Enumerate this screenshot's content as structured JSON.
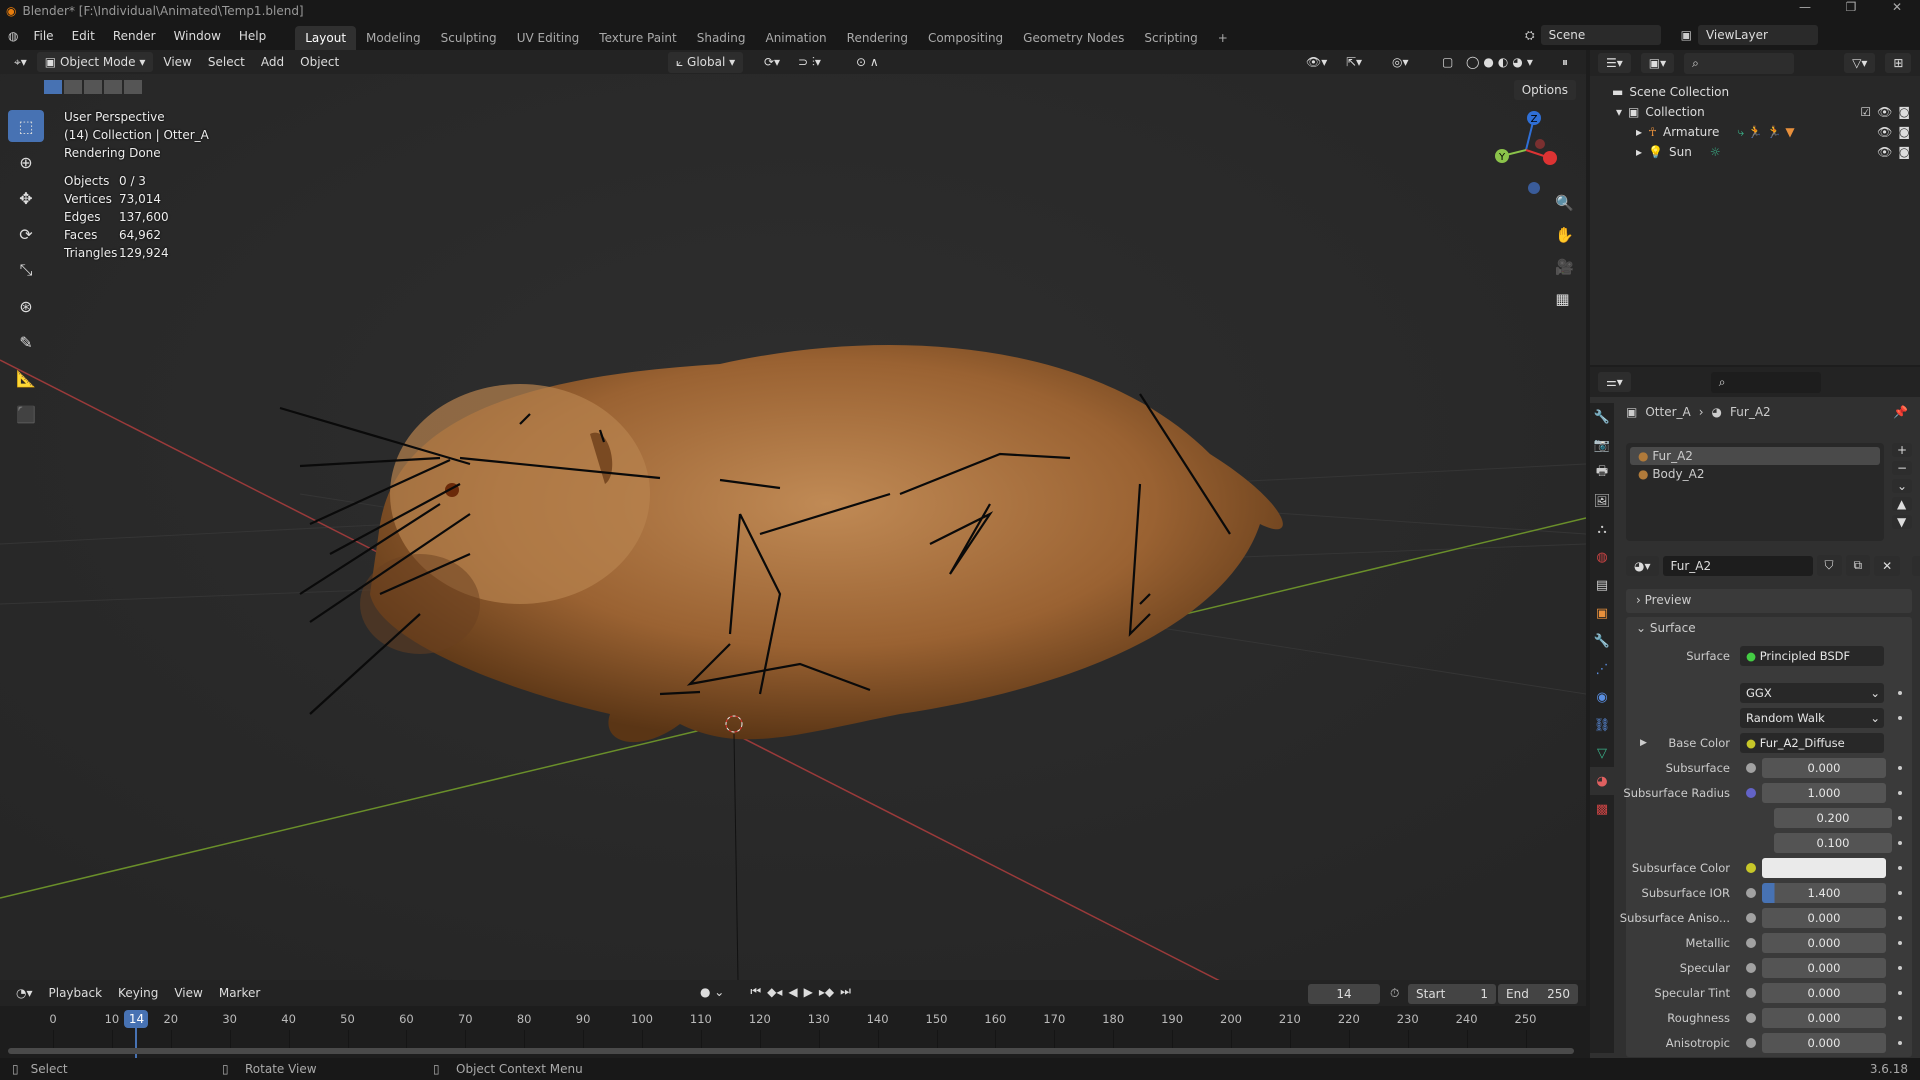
{
  "window": {
    "title": "Blender* [F:\\Individual\\Animated\\Temp1.blend]"
  },
  "menus": [
    "File",
    "Edit",
    "Render",
    "Window",
    "Help"
  ],
  "workspaces": [
    "Layout",
    "Modeling",
    "Sculpting",
    "UV Editing",
    "Texture Paint",
    "Shading",
    "Animation",
    "Rendering",
    "Compositing",
    "Geometry Nodes",
    "Scripting",
    "+"
  ],
  "scene": {
    "label": "Scene",
    "view_layer": "ViewLayer"
  },
  "viewport_header": {
    "mode": "Object Mode",
    "menus": [
      "View",
      "Select",
      "Add",
      "Object"
    ],
    "orientation": "Global",
    "options": "Options"
  },
  "overlay": {
    "perspective": "User Perspective",
    "collection": "(14) Collection | Otter_A",
    "status": "Rendering Done",
    "stats": [
      {
        "k": "Objects",
        "v": "0 / 3"
      },
      {
        "k": "Vertices",
        "v": "73,014"
      },
      {
        "k": "Edges",
        "v": "137,600"
      },
      {
        "k": "Faces",
        "v": "64,962"
      },
      {
        "k": "Triangles",
        "v": "129,924"
      }
    ]
  },
  "gizmo": {
    "z": "Z",
    "y": "Y"
  },
  "outliner": {
    "scene_collection": "Scene Collection",
    "collection": "Collection",
    "items": [
      "Armature",
      "Sun"
    ]
  },
  "properties": {
    "breadcrumb_object": "Otter_A",
    "breadcrumb_material": "Fur_A2",
    "slots": [
      "Fur_A2",
      "Body_A2"
    ],
    "material_name": "Fur_A2",
    "panels": {
      "preview": "Preview",
      "surface": "Surface"
    },
    "surface_label": "Surface",
    "surface_value": "Principled BSDF",
    "distribution": "GGX",
    "subsurface_method": "Random Walk",
    "base_color_label": "Base Color",
    "base_color_value": "Fur_A2_Diffuse",
    "rows": [
      {
        "label": "Subsurface",
        "value": "0.000",
        "socket": "#a1a1a1"
      },
      {
        "label": "Subsurface Radius",
        "value": "1.000",
        "socket": "#6363c7"
      },
      {
        "label": "",
        "value": "0.200",
        "socket": ""
      },
      {
        "label": "",
        "value": "0.100",
        "socket": ""
      },
      {
        "label": "Subsurface Color",
        "value": "",
        "socket": "#c7c729"
      },
      {
        "label": "Subsurface IOR",
        "value": "1.400",
        "socket": "#a1a1a1"
      },
      {
        "label": "Subsurface Aniso...",
        "value": "0.000",
        "socket": "#a1a1a1"
      },
      {
        "label": "Metallic",
        "value": "0.000",
        "socket": "#a1a1a1"
      },
      {
        "label": "Specular",
        "value": "0.000",
        "socket": "#a1a1a1"
      },
      {
        "label": "Specular Tint",
        "value": "0.000",
        "socket": "#a1a1a1"
      },
      {
        "label": "Roughness",
        "value": "0.000",
        "socket": "#a1a1a1"
      },
      {
        "label": "Anisotropic",
        "value": "0.000",
        "socket": "#a1a1a1"
      }
    ]
  },
  "timeline": {
    "menus": [
      "Playback",
      "Keying",
      "View",
      "Marker"
    ],
    "current_frame": "14",
    "start_label": "Start",
    "start": "1",
    "end_label": "End",
    "end": "250",
    "ticks": [
      0,
      10,
      20,
      30,
      40,
      50,
      60,
      70,
      80,
      90,
      100,
      110,
      120,
      130,
      140,
      150,
      160,
      170,
      180,
      190,
      200,
      210,
      220,
      230,
      240,
      250
    ]
  },
  "statusbar": {
    "select": "Select",
    "rotate": "Rotate View",
    "context": "Object Context Menu",
    "version": "3.6.18"
  },
  "colors": {
    "accent": "#4772b3",
    "x_axis": "#b83c3c",
    "y_axis": "#6f9a2a"
  }
}
